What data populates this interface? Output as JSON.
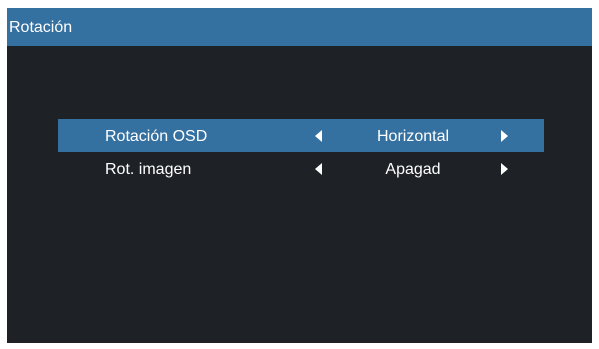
{
  "window": {
    "title": "Rotación"
  },
  "menu": {
    "items": [
      {
        "label": "Rotación OSD",
        "value": "Horizontal",
        "selected": true,
        "left_arrow_icon": "triangle-left-icon",
        "right_arrow_icon": "triangle-right-icon"
      },
      {
        "label": "Rot. imagen",
        "value": "Apagad",
        "selected": false,
        "left_arrow_icon": "triangle-left-icon",
        "right_arrow_icon": "triangle-right-icon"
      }
    ]
  },
  "colors": {
    "header_background": "#3470a0",
    "selection_highlight": "#3470a0",
    "panel_background": "#1e2227",
    "text": "#ffffff"
  }
}
